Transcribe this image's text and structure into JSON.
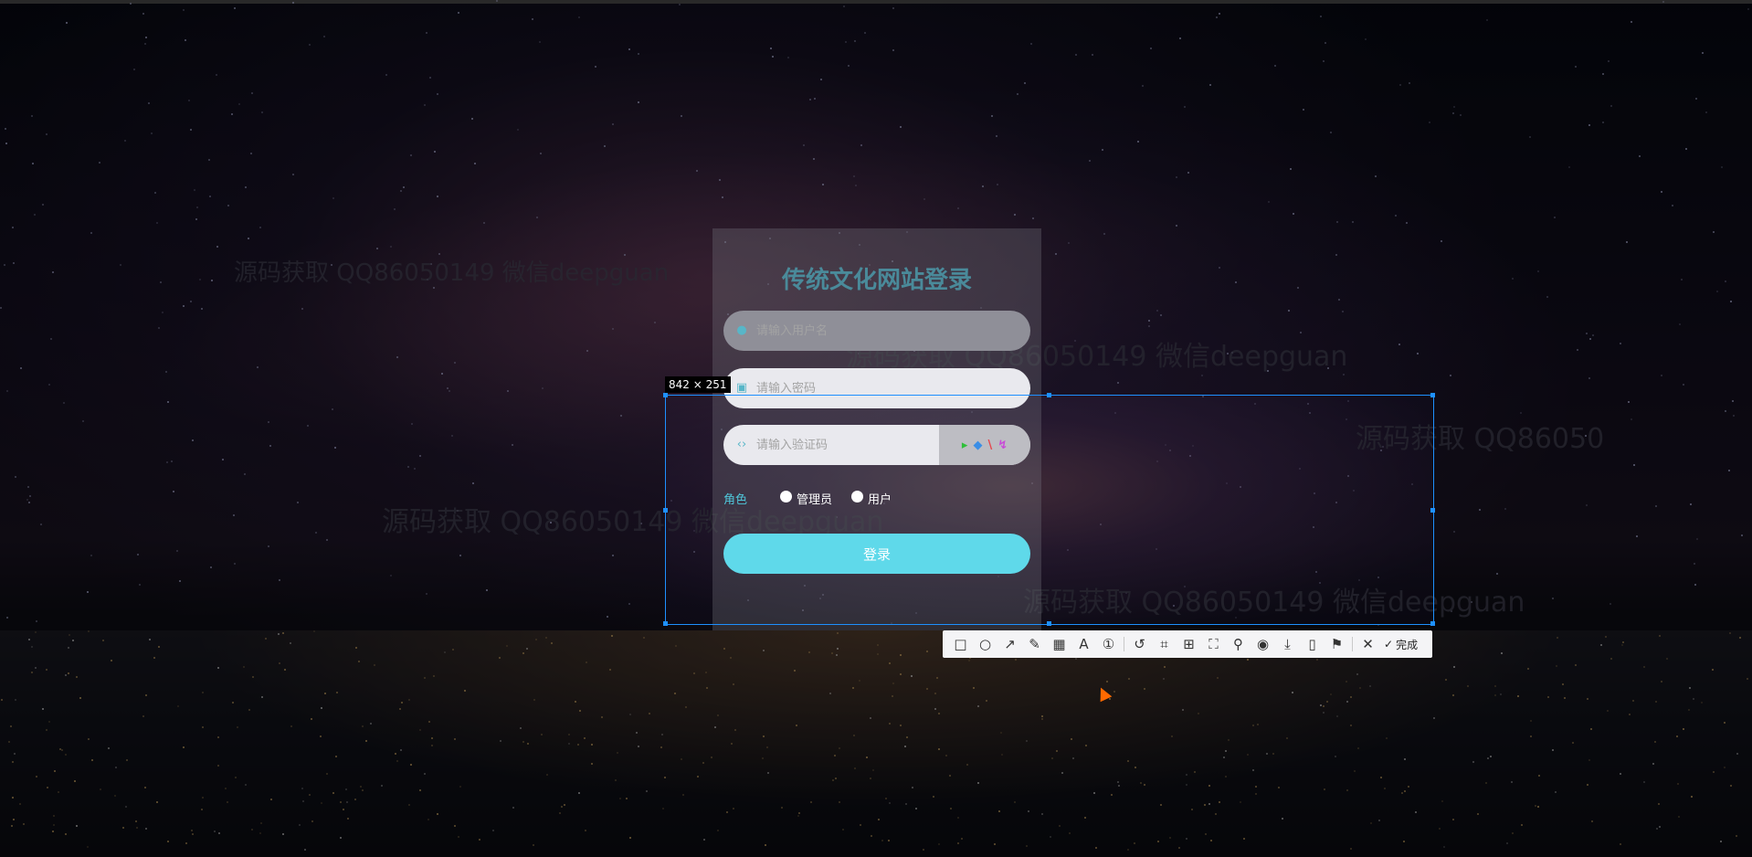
{
  "login": {
    "title": "传统文化网站登录",
    "username_placeholder": "请输入用户名",
    "password_placeholder": "请输入密码",
    "captcha_placeholder": "请输入验证码",
    "captcha_chars": [
      "▸",
      "◆",
      "\\",
      "↯"
    ],
    "role_label": "角色",
    "role_admin": "管理员",
    "role_user": "用户",
    "submit": "登录"
  },
  "selection": {
    "size_text": "842 × 251"
  },
  "toolbar": {
    "done_label": "完成"
  },
  "watermarks": [
    "源码获取 QQ86050149 微信deepguan",
    "源码获取 QQ86050149 微信deepguan",
    "源码获取 QQ86050149 微信deepguan",
    "源码获取 QQ86050149 微信deepguan",
    "源码获取 QQ86050149 微信deepguan",
    "源码获取 QQ86050"
  ],
  "colors": {
    "accent": "#5fd9ea",
    "selection_border": "#1e90ff"
  }
}
